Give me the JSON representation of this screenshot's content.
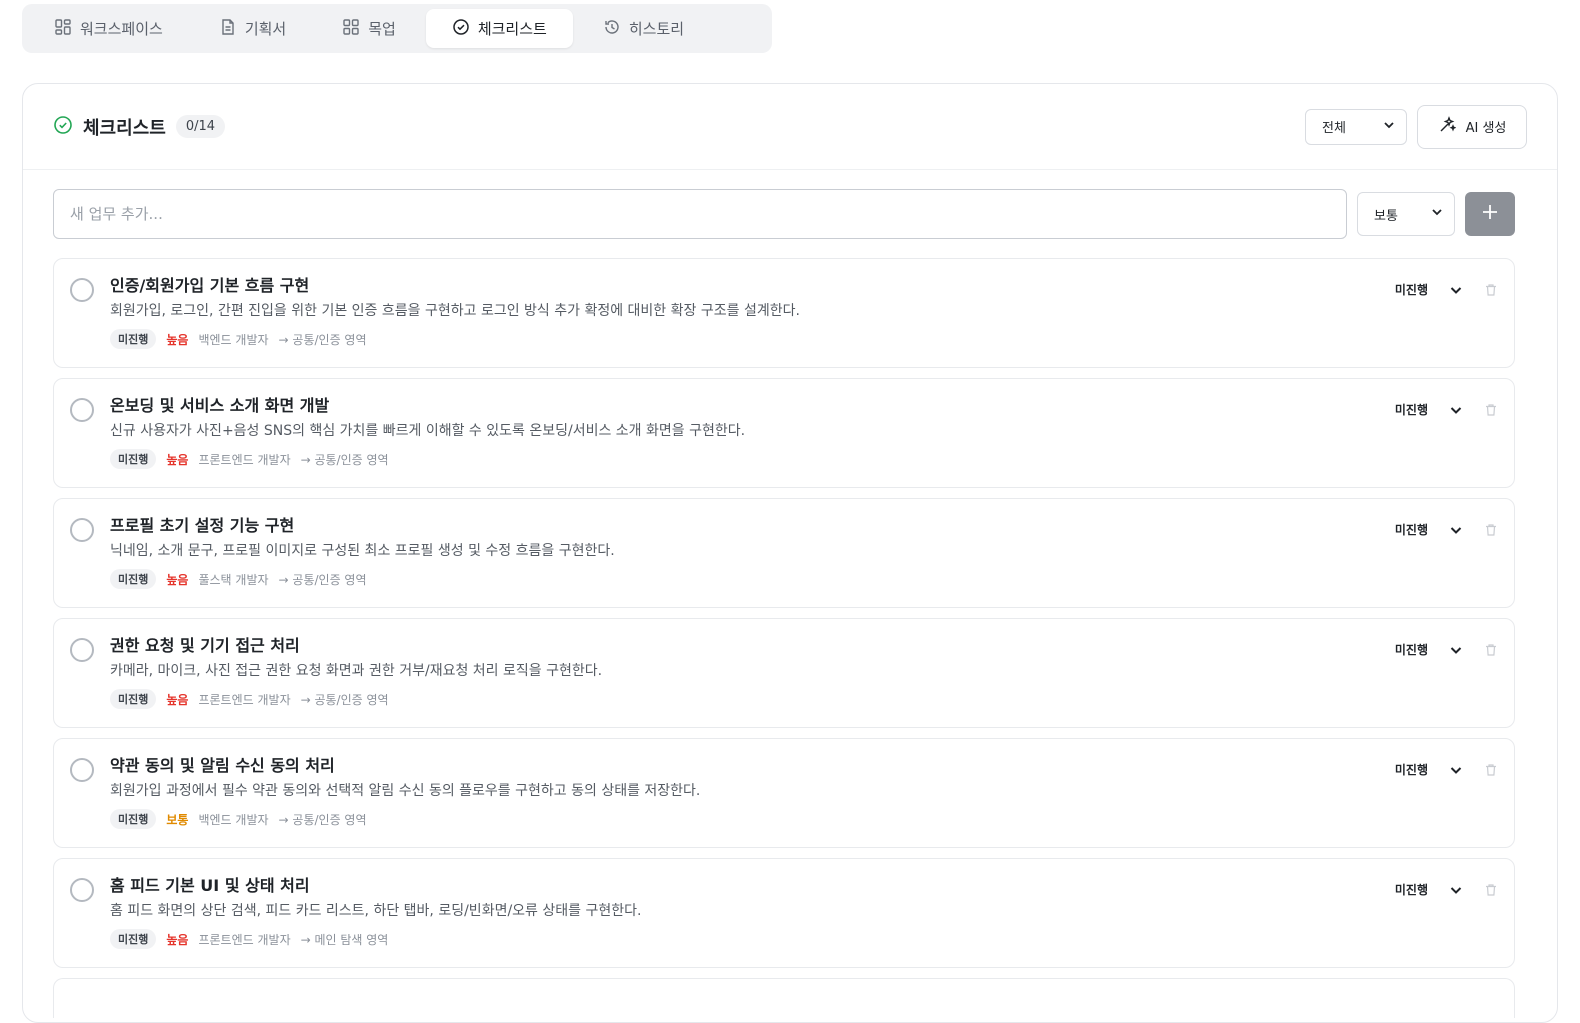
{
  "tabs": [
    {
      "label": "워크스페이스",
      "icon": "layout-grid-icon"
    },
    {
      "label": "기획서",
      "icon": "document-icon"
    },
    {
      "label": "목업",
      "icon": "grid-icon"
    },
    {
      "label": "체크리스트",
      "icon": "check-circle-icon",
      "active": true
    },
    {
      "label": "히스토리",
      "icon": "history-icon"
    }
  ],
  "checklist": {
    "title": "체크리스트",
    "count": "0/14",
    "filter_value": "전체",
    "ai_button": "AI 생성"
  },
  "add": {
    "placeholder": "새 업무 추가...",
    "priority_value": "보통"
  },
  "tasks": [
    {
      "title": "인증/회원가입 기본 흐름 구현",
      "desc": "회원가입, 로그인, 간편 진입을 위한 기본 인증 흐름을 구현하고 로그인 방식 추가 확정에 대비한 확장 구조를 설계한다.",
      "status": "미진행",
      "priority": "높음",
      "role": "백엔드 개발자",
      "area": "→ 공통/인증 영역",
      "status_right": "미진행"
    },
    {
      "title": "온보딩 및 서비스 소개 화면 개발",
      "desc": "신규 사용자가 사진+음성 SNS의 핵심 가치를 빠르게 이해할 수 있도록 온보딩/서비스 소개 화면을 구현한다.",
      "status": "미진행",
      "priority": "높음",
      "role": "프론트엔드 개발자",
      "area": "→ 공통/인증 영역",
      "status_right": "미진행"
    },
    {
      "title": "프로필 초기 설정 기능 구현",
      "desc": "닉네임, 소개 문구, 프로필 이미지로 구성된 최소 프로필 생성 및 수정 흐름을 구현한다.",
      "status": "미진행",
      "priority": "높음",
      "role": "풀스택 개발자",
      "area": "→ 공통/인증 영역",
      "status_right": "미진행"
    },
    {
      "title": "권한 요청 및 기기 접근 처리",
      "desc": "카메라, 마이크, 사진 접근 권한 요청 화면과 권한 거부/재요청 처리 로직을 구현한다.",
      "status": "미진행",
      "priority": "높음",
      "role": "프론트엔드 개발자",
      "area": "→ 공통/인증 영역",
      "status_right": "미진행"
    },
    {
      "title": "약관 동의 및 알림 수신 동의 처리",
      "desc": "회원가입 과정에서 필수 약관 동의와 선택적 알림 수신 동의 플로우를 구현하고 동의 상태를 저장한다.",
      "status": "미진행",
      "priority": "보통",
      "role": "백엔드 개발자",
      "area": "→ 공통/인증 영역",
      "status_right": "미진행"
    },
    {
      "title": "홈 피드 기본 UI 및 상태 처리",
      "desc": "홈 피드 화면의 상단 검색, 피드 카드 리스트, 하단 탭바, 로딩/빈화면/오류 상태를 구현한다.",
      "status": "미진행",
      "priority": "높음",
      "role": "프론트엔드 개발자",
      "area": "→ 메인 탐색 영역",
      "status_right": "미진행"
    }
  ],
  "colors": {
    "priority_high": "#e5342b",
    "priority_normal": "#e08a00",
    "success": "#22a654"
  }
}
